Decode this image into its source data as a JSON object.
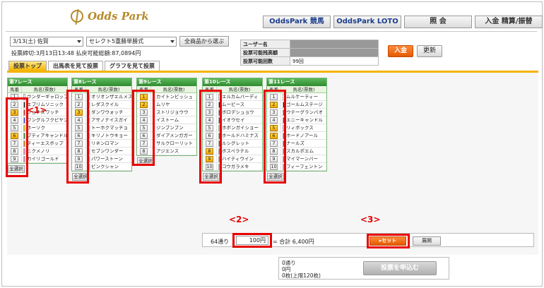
{
  "header": {
    "logo": "Odds Park",
    "nav": [
      "OddsPark 競馬",
      "OddsPark LOTO",
      "照 会",
      "入金 精算/振替"
    ]
  },
  "selector": {
    "race_day": "3/13(土) 佐賀",
    "bet_type": "セレクト5重勝単勝式",
    "all_button": "全商品から選ぶ",
    "deadline": "投票締切:3月13日13:48  払戻可能総額:87,0894円"
  },
  "user": {
    "rows": [
      {
        "label": "ユーザー名",
        "value": ""
      },
      {
        "label": "投票可能残高額",
        "value": ""
      },
      {
        "label": "投票可能回数",
        "value": "99回"
      }
    ],
    "deposit_button": "入金",
    "refresh_button": "更新"
  },
  "tabs": [
    "投票トップ",
    "出馬表を見て投票",
    "グラフを見て投票"
  ],
  "race_header": {
    "num": "馬番",
    "name": "馬名(票数)"
  },
  "select_all": "全選択",
  "races": [
    {
      "title": "第7レース",
      "horses": [
        {
          "n": "1",
          "name": "ウンダーギャロップ",
          "on": false,
          "waku": "#ffffff"
        },
        {
          "n": "2",
          "name": "エブリムソニック",
          "on": false,
          "waku": "#222222"
        },
        {
          "n": "3",
          "name": "ジョナスワッチ",
          "on": true,
          "waku": "#e83030"
        },
        {
          "n": "4",
          "name": "ワングルフクビヤン",
          "on": false,
          "waku": "#2a5bd8"
        },
        {
          "n": "5",
          "name": "ホーソク",
          "on": false,
          "waku": "#f0d000"
        },
        {
          "n": "6",
          "name": "プティアキャンドル",
          "on": true,
          "waku": "#2a9a2a"
        },
        {
          "n": "7",
          "name": "ティーエスボップ",
          "on": false,
          "waku": "#f07800"
        },
        {
          "n": "8",
          "name": "ニクメノリ",
          "on": false,
          "waku": "#f090b0"
        },
        {
          "n": "9",
          "name": "カイリゴールド",
          "on": false,
          "waku": "#f090b0"
        }
      ]
    },
    {
      "title": "第8レース",
      "horses": [
        {
          "n": "1",
          "name": "オリオンザエルメス",
          "on": false,
          "waku": "#ffffff"
        },
        {
          "n": "2",
          "name": "レダスクイル",
          "on": false,
          "waku": "#222222"
        },
        {
          "n": "3",
          "name": "ダンワウォッチ",
          "on": true,
          "waku": "#e83030"
        },
        {
          "n": "4",
          "name": "アサノナイスガイ",
          "on": false,
          "waku": "#2a5bd8"
        },
        {
          "n": "5",
          "name": "トーホクマッチョ",
          "on": false,
          "waku": "#f0d000"
        },
        {
          "n": "6",
          "name": "キリノトウキョー",
          "on": false,
          "waku": "#2a9a2a"
        },
        {
          "n": "7",
          "name": "リネンロマン",
          "on": false,
          "waku": "#2a9a2a"
        },
        {
          "n": "8",
          "name": "セブンワンダー",
          "on": false,
          "waku": "#f07800"
        },
        {
          "n": "9",
          "name": "パワーストーン",
          "on": false,
          "waku": "#f07800"
        },
        {
          "n": "10",
          "name": "ピンクシャン",
          "on": false,
          "waku": "#f090b0"
        }
      ]
    },
    {
      "title": "第9レース",
      "horses": [
        {
          "n": "1",
          "name": "カイトンピッシュ",
          "on": true,
          "waku": "#ffffff"
        },
        {
          "n": "2",
          "name": "ムリヤ",
          "on": true,
          "waku": "#222222"
        },
        {
          "n": "3",
          "name": "ストリジョウウ",
          "on": false,
          "waku": "#e83030"
        },
        {
          "n": "4",
          "name": "イストーム",
          "on": false,
          "waku": "#2a5bd8"
        },
        {
          "n": "5",
          "name": "ジンプンプン",
          "on": false,
          "waku": "#f0d000"
        },
        {
          "n": "6",
          "name": "ダイアメンガガー",
          "on": false,
          "waku": "#2a9a2a"
        },
        {
          "n": "7",
          "name": "サルクローリット",
          "on": false,
          "waku": "#f07800"
        },
        {
          "n": "8",
          "name": "アジエンス",
          "on": false,
          "waku": "#f090b0"
        }
      ]
    },
    {
      "title": "第10レース",
      "horses": [
        {
          "n": "1",
          "name": "エルカムバーディ",
          "on": false,
          "waku": "#ffffff"
        },
        {
          "n": "2",
          "name": "ムーピース",
          "on": false,
          "waku": "#222222"
        },
        {
          "n": "3",
          "name": "ボロデシュョウ",
          "on": false,
          "waku": "#e83030"
        },
        {
          "n": "4",
          "name": "イオウセイ",
          "on": false,
          "waku": "#2a5bd8"
        },
        {
          "n": "5",
          "name": "ホボンガイショー",
          "on": false,
          "waku": "#f0d000"
        },
        {
          "n": "6",
          "name": "ホールドハミナス",
          "on": false,
          "waku": "#2a9a2a"
        },
        {
          "n": "7",
          "name": "ルシグレット",
          "on": false,
          "waku": "#2a9a2a"
        },
        {
          "n": "8",
          "name": "ボスペラテル",
          "on": true,
          "waku": "#f07800"
        },
        {
          "n": "9",
          "name": "ハイティウイン",
          "on": true,
          "waku": "#f07800"
        },
        {
          "n": "10",
          "name": "コウガラメキ",
          "on": false,
          "waku": "#f090b0"
        }
      ]
    },
    {
      "title": "第11レース",
      "horses": [
        {
          "n": "1",
          "name": "ムルケーティー",
          "on": false,
          "waku": "#ffffff"
        },
        {
          "n": "2",
          "name": "ゴールムステージ",
          "on": true,
          "waku": "#222222"
        },
        {
          "n": "3",
          "name": "ウテーグランバオ",
          "on": false,
          "waku": "#e83030"
        },
        {
          "n": "4",
          "name": "エニーキャンドル",
          "on": false,
          "waku": "#2a5bd8"
        },
        {
          "n": "5",
          "name": "リィボックス",
          "on": true,
          "waku": "#f0d000"
        },
        {
          "n": "6",
          "name": "ホードノアール",
          "on": true,
          "waku": "#2a9a2a"
        },
        {
          "n": "7",
          "name": "ナールズ",
          "on": false,
          "waku": "#2a9a2a"
        },
        {
          "n": "8",
          "name": "スカルポエム",
          "on": false,
          "waku": "#f07800"
        },
        {
          "n": "9",
          "name": "マイマーンバー",
          "on": false,
          "waku": "#f07800"
        },
        {
          "n": "10",
          "name": "フィーフェントン",
          "on": false,
          "waku": "#f090b0"
        }
      ]
    }
  ],
  "annotations": [
    "<1>",
    "<2>",
    "<3>"
  ],
  "calc": {
    "points": "64通り",
    "amount": "100円",
    "total": "= 合計 6,400円",
    "set_button": "▸セット",
    "expand_button": "展開"
  },
  "summary": {
    "lines": [
      "0通り",
      "0円",
      "0枚(上限120枚)"
    ],
    "apply_button": "投票を申込む"
  }
}
